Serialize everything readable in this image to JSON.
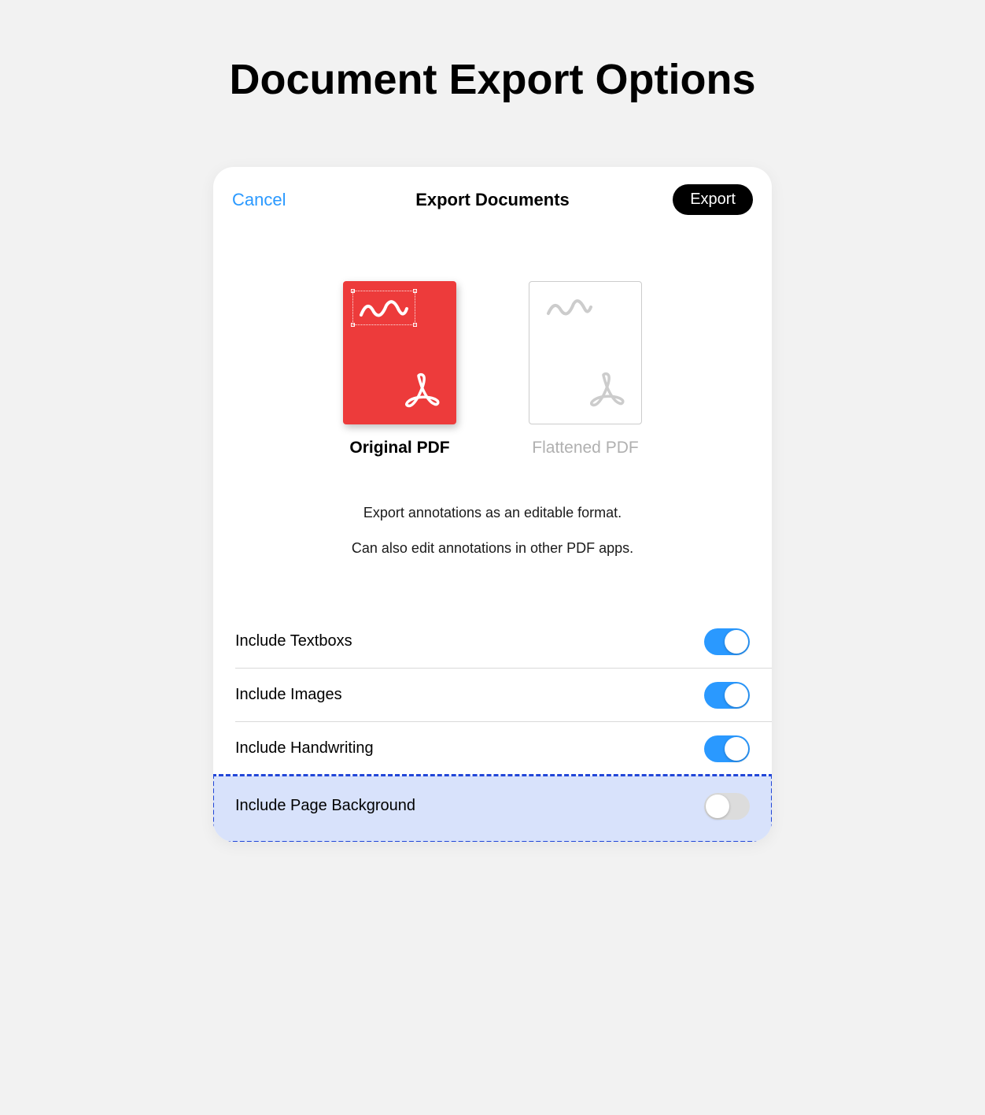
{
  "page_title": "Document Export Options",
  "modal": {
    "cancel_label": "Cancel",
    "title": "Export Documents",
    "export_label": "Export"
  },
  "options": [
    {
      "id": "original",
      "label": "Original PDF",
      "selected": true
    },
    {
      "id": "flattened",
      "label": "Flattened PDF",
      "selected": false
    }
  ],
  "description": {
    "line1": "Export annotations as an editable format.",
    "line2": "Can also edit annotations in other PDF apps."
  },
  "toggles": [
    {
      "label": "Include Textboxs",
      "on": true,
      "highlighted": false
    },
    {
      "label": "Include Images",
      "on": true,
      "highlighted": false
    },
    {
      "label": "Include Handwriting",
      "on": true,
      "highlighted": false
    },
    {
      "label": "Include Page Background",
      "on": false,
      "highlighted": true
    }
  ]
}
